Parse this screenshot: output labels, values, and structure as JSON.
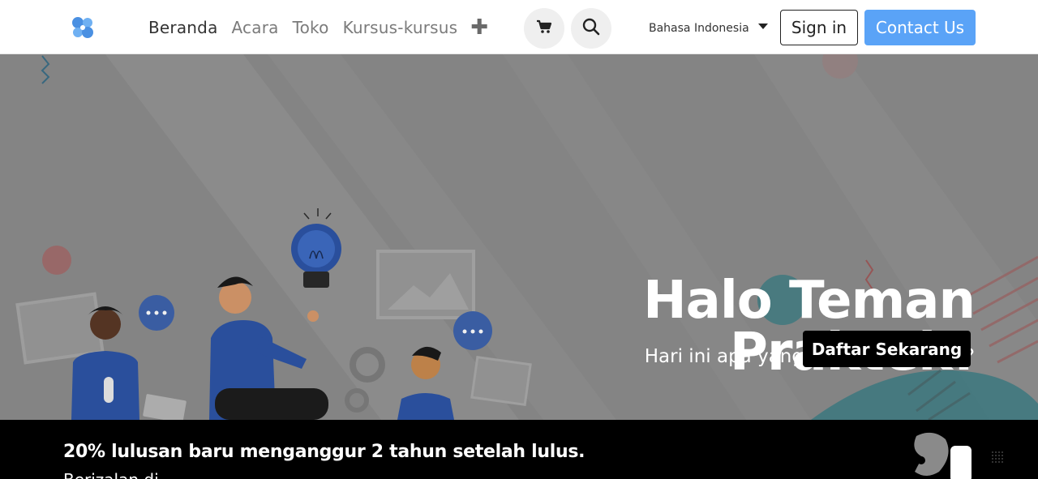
{
  "header": {
    "nav": [
      {
        "label": "Beranda",
        "active": true
      },
      {
        "label": "Acara",
        "active": false
      },
      {
        "label": "Toko",
        "active": false
      },
      {
        "label": "Kursus-kursus",
        "active": false
      }
    ],
    "more_icon": "plus-icon",
    "cart_icon": "cart-icon",
    "search_icon": "search-icon",
    "language": "Bahasa Indonesia",
    "signin_label": "Sign in",
    "contact_label": "Contact Us",
    "colors": {
      "accent": "#5aa3f7",
      "logo": "#4a90e2"
    }
  },
  "hero": {
    "title": "Halo Teman Praktek!",
    "subtitle": "Hari ini apa yang mau kamu capai?",
    "cta_label": "Daftar Sekarang"
  },
  "banner": {
    "title": "20% lulusan baru menganggur 2 tahun setelah lulus.",
    "subtitle": "Berizalan di..."
  }
}
